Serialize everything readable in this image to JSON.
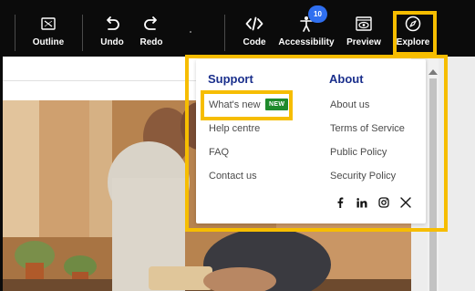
{
  "toolbar": {
    "outline_label": "Outline",
    "undo_label": "Undo",
    "redo_label": "Redo",
    "code_label": "Code",
    "accessibility_label": "Accessibility",
    "accessibility_badge": "10",
    "preview_label": "Preview",
    "explore_label": "Explore"
  },
  "menu": {
    "support": {
      "heading": "Support",
      "items": [
        {
          "label": "What's new",
          "badge": "NEW"
        },
        {
          "label": "Help centre"
        },
        {
          "label": "FAQ"
        },
        {
          "label": "Contact us"
        }
      ]
    },
    "about": {
      "heading": "About",
      "items": [
        {
          "label": "About us"
        },
        {
          "label": "Terms of Service"
        },
        {
          "label": "Public Policy"
        },
        {
          "label": "Security Policy"
        }
      ]
    },
    "social": [
      "facebook-icon",
      "linkedin-icon",
      "instagram-icon",
      "x-icon"
    ]
  },
  "colors": {
    "toolbar_bg": "#0b0b0b",
    "accent_blue": "#2f6ff0",
    "heading_blue": "#1a2f8c",
    "new_badge_green": "#1f8a2c",
    "highlight_yellow": "#f6bd00"
  }
}
